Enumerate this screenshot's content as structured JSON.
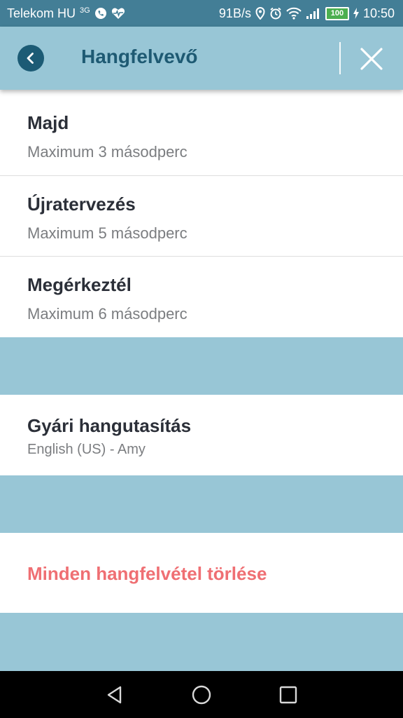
{
  "status_bar": {
    "carrier": "Telekom HU",
    "network_type": "3G",
    "net_speed": "91B/s",
    "battery": "100",
    "time": "10:50",
    "icons": [
      "phone-icon",
      "heart-rate-icon",
      "location-icon",
      "alarm-icon",
      "wifi-icon",
      "signal-icon",
      "battery-icon",
      "charging-icon"
    ]
  },
  "app_bar": {
    "title": "Hangfelvevő",
    "icons": [
      "back-icon",
      "close-icon"
    ]
  },
  "recordings": [
    {
      "title": "Majd",
      "subtitle": "Maximum 3 másodperc"
    },
    {
      "title": "Újratervezés",
      "subtitle": "Maximum 5 másodperc"
    },
    {
      "title": "Megérkeztél",
      "subtitle": "Maximum 6 másodperc"
    }
  ],
  "voice": {
    "title": "Gyári hangutasítás",
    "subtitle": "English (US) - Amy"
  },
  "delete_all": {
    "label": "Minden hangfelvétel törlése",
    "color": "#ef6f73"
  },
  "colors": {
    "status_bar": "#437e96",
    "app_bar": "#98c6d6",
    "title": "#1e5a73",
    "back_button": "#1c5b75",
    "background": "#98c6d6"
  },
  "nav_bar": {
    "icons": [
      "back-triangle-icon",
      "home-circle-icon",
      "recents-square-icon"
    ]
  }
}
